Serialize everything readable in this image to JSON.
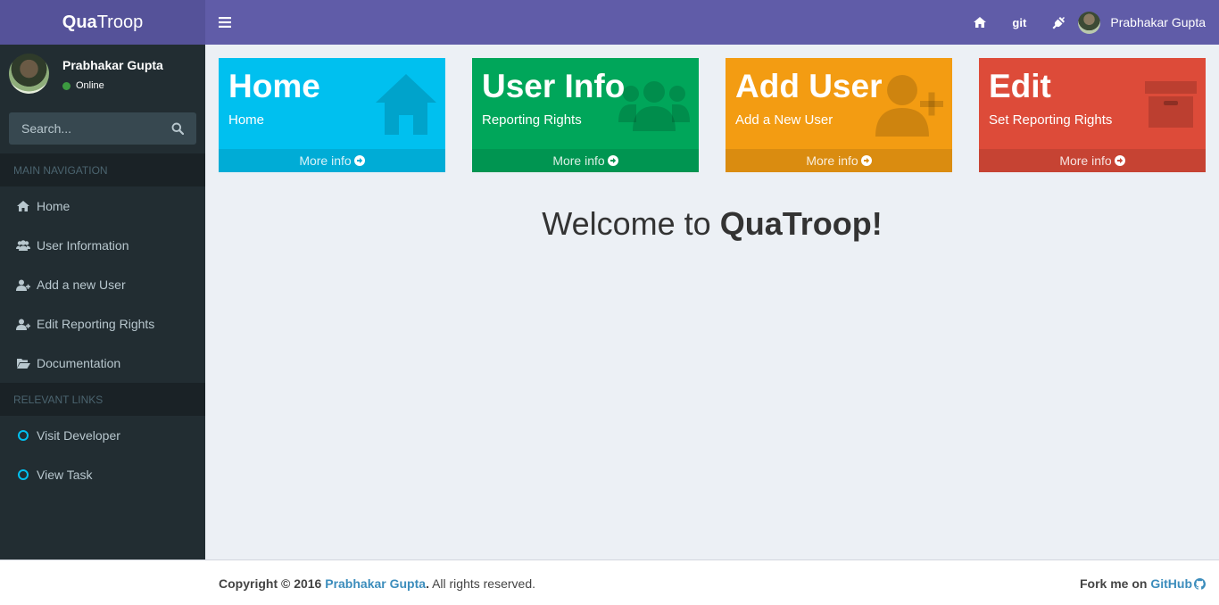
{
  "header": {
    "logo_bold": "Qua",
    "logo_rest": "Troop",
    "git_label": "git",
    "user_name": "Prabhakar Gupta"
  },
  "sidebar": {
    "user_name": "Prabhakar Gupta",
    "status": "Online",
    "search_placeholder": "Search...",
    "main_header": "MAIN NAVIGATION",
    "main_items": [
      {
        "label": "Home",
        "icon": "home-icon"
      },
      {
        "label": "User Information",
        "icon": "users-icon"
      },
      {
        "label": "Add a new User",
        "icon": "user-plus-icon"
      },
      {
        "label": "Edit Reporting Rights",
        "icon": "user-plus-icon"
      },
      {
        "label": "Documentation",
        "icon": "folder-open-icon"
      }
    ],
    "links_header": "RELEVANT LINKS",
    "link_items": [
      {
        "label": "Visit Developer",
        "icon": "circle-icon"
      },
      {
        "label": "View Task",
        "icon": "circle-icon"
      }
    ]
  },
  "boxes": [
    {
      "title": "Home",
      "subtitle": "Home",
      "footer": "More info",
      "color": "#00c0ef",
      "icon": "home-icon"
    },
    {
      "title": "User Info",
      "subtitle": "Reporting Rights",
      "footer": "More info",
      "color": "#00a65a",
      "icon": "users-icon"
    },
    {
      "title": "Add User",
      "subtitle": "Add a New User",
      "footer": "More info",
      "color": "#f39c12",
      "icon": "user-plus-icon"
    },
    {
      "title": "Edit",
      "subtitle": "Set Reporting Rights",
      "footer": "More info",
      "color": "#dd4b39",
      "icon": "archive-icon"
    }
  ],
  "welcome": {
    "prefix": "Welcome to ",
    "brand": "QuaTroop!"
  },
  "footer": {
    "copyright_prefix": "Copyright © 2016 ",
    "author": "Prabhakar Gupta",
    "period": ".",
    "rights": " All rights reserved.",
    "fork_label": "Fork me on ",
    "github": "GitHub"
  },
  "colors": {
    "header": "#605ca8",
    "logo_bg": "#555299",
    "sidebar": "#222d32",
    "content_bg": "#ecf0f5",
    "link": "#3c8dbc"
  }
}
